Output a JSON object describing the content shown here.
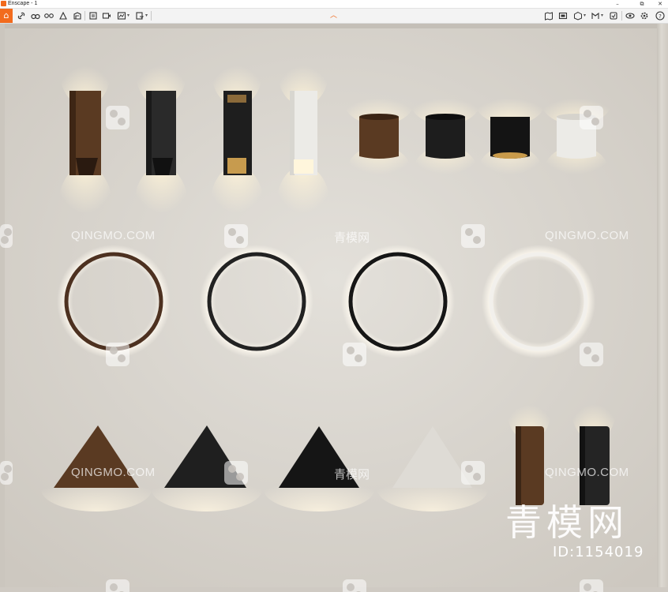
{
  "titlebar": {
    "title": "Enscape - 1",
    "minimize": "–",
    "restore": "⧉",
    "close": "✕"
  },
  "toolbar": {
    "left_icons": [
      "link-icon",
      "binoculars-icon",
      "timeline-icon",
      "camera-icon",
      "collaborate-icon",
      "fly-icon",
      "video-icon",
      "screenshot-icon",
      "batch-render-icon",
      "export-icon"
    ],
    "right_icons": [
      "map-icon",
      "capture-icon",
      "asset-library-icon",
      "material-icon",
      "settings-view-icon",
      "visual-settings-icon",
      "preferences-icon",
      "help-icon"
    ],
    "collapse_glyph": "︿"
  },
  "colors": {
    "accent": "#f26b1d",
    "wall": "#d7d3cd",
    "bronze": "#5a3a22",
    "black": "#1e1e1e",
    "white_fixture": "#e8e6e2",
    "glow": "#fff3d6"
  },
  "watermarks": {
    "latin": "QINGMO.COM",
    "chinese": "青模网",
    "big_chinese": "青模网",
    "id_text": "ID:1154019"
  }
}
